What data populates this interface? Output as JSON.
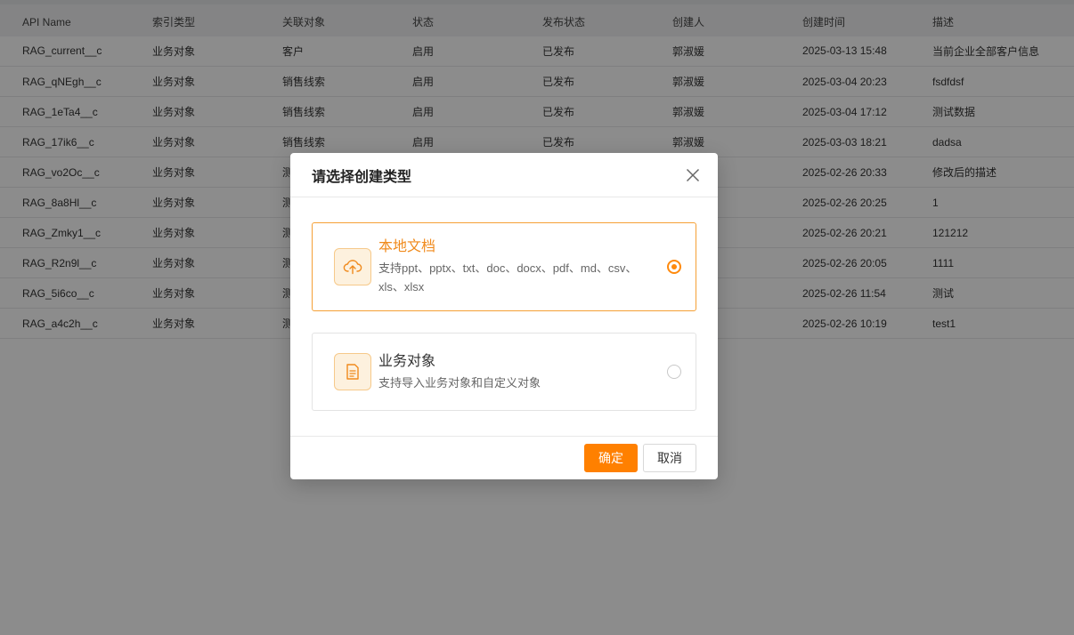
{
  "table": {
    "columns": [
      "API Name",
      "索引类型",
      "关联对象",
      "状态",
      "发布状态",
      "创建人",
      "创建时间",
      "描述"
    ],
    "rows": [
      [
        "RAG_current__c",
        "业务对象",
        "客户",
        "启用",
        "已发布",
        "郭淑媛",
        "2025-03-13 15:48",
        "当前企业全部客户信息"
      ],
      [
        "RAG_qNEgh__c",
        "业务对象",
        "销售线索",
        "启用",
        "已发布",
        "郭淑媛",
        "2025-03-04 20:23",
        "fsdfdsf"
      ],
      [
        "RAG_1eTa4__c",
        "业务对象",
        "销售线索",
        "启用",
        "已发布",
        "郭淑媛",
        "2025-03-04 17:12",
        "测试数据"
      ],
      [
        "RAG_17ik6__c",
        "业务对象",
        "销售线索",
        "启用",
        "已发布",
        "郭淑媛",
        "2025-03-03 18:21",
        "dadsa"
      ],
      [
        "RAG_vo2Oc__c",
        "业务对象",
        "测",
        "",
        "",
        "",
        "2025-02-26 20:33",
        "修改后的描述"
      ],
      [
        "RAG_8a8Hl__c",
        "业务对象",
        "测",
        "",
        "",
        "",
        "2025-02-26 20:25",
        "1"
      ],
      [
        "RAG_Zmky1__c",
        "业务对象",
        "测",
        "",
        "",
        "",
        "2025-02-26 20:21",
        "121212"
      ],
      [
        "RAG_R2n9l__c",
        "业务对象",
        "测",
        "",
        "",
        "",
        "2025-02-26 20:05",
        "1111"
      ],
      [
        "RAG_5i6co__c",
        "业务对象",
        "测",
        "",
        "",
        "",
        "2025-02-26 11:54",
        "测试"
      ],
      [
        "RAG_a4c2h__c",
        "业务对象",
        "测",
        "",
        "",
        "",
        "2025-02-26 10:19",
        "test1"
      ]
    ]
  },
  "modal": {
    "title": "请选择创建类型",
    "options": [
      {
        "title": "本地文档",
        "desc": "支持ppt、pptx、txt、doc、docx、pdf、md、csv、xls、xlsx",
        "icon": "cloud-upload-icon",
        "selected": true
      },
      {
        "title": "业务对象",
        "desc": "支持导入业务对象和自定义对象",
        "icon": "document-icon",
        "selected": false
      }
    ],
    "confirm_label": "确定",
    "cancel_label": "取消"
  },
  "colors": {
    "accent": "#ff8000",
    "overlay": "rgba(0,0,0,0.45)"
  }
}
